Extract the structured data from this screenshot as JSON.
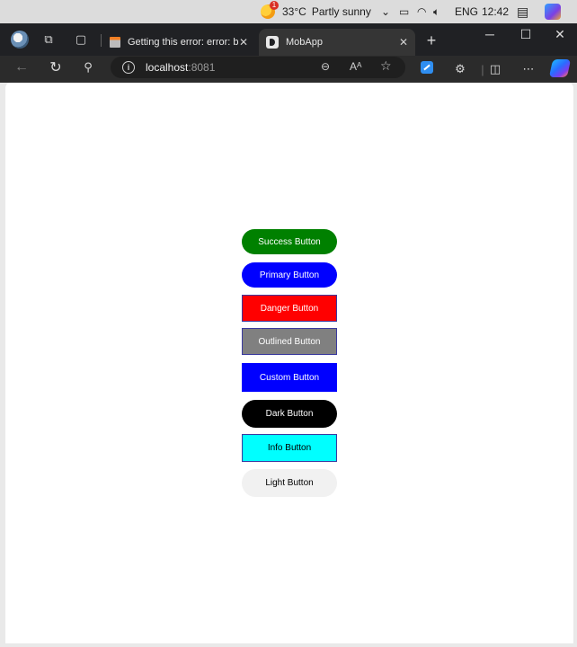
{
  "taskbar": {
    "weather_icon": "weather-sun-icon",
    "temperature": "33°C",
    "condition": "Partly sunny",
    "language": "ENG",
    "time": "12:42"
  },
  "browser": {
    "tabs": [
      {
        "title": "Getting this error: error: bu",
        "active": false
      },
      {
        "title": "MobApp",
        "active": true
      }
    ],
    "address": {
      "host": "localhost",
      "port": ":8081"
    }
  },
  "buttons": [
    {
      "label": "Success Button",
      "bg": "#008000",
      "color": "#ffffff",
      "shape": "pill"
    },
    {
      "label": "Primary Button",
      "bg": "#0000ff",
      "color": "#ffffff",
      "shape": "pill"
    },
    {
      "label": "Danger Button",
      "bg": "#ff0000",
      "color": "#ffffff",
      "shape": "square",
      "border": "#3a3aa0"
    },
    {
      "label": "Outlined Button",
      "bg": "#808080",
      "color": "#ffffff",
      "shape": "square",
      "border": "#3a3aa0"
    },
    {
      "label": "Custom Button",
      "bg": "#0000ff",
      "color": "#ffffff",
      "shape": "square"
    },
    {
      "label": "Dark Button",
      "bg": "#000000",
      "color": "#ffffff",
      "shape": "pill"
    },
    {
      "label": "Info Button",
      "bg": "#00ffff",
      "color": "#000000",
      "shape": "square",
      "border": "#3a3aa0"
    },
    {
      "label": "Light Button",
      "bg": "#f1f1f1",
      "color": "#000000",
      "shape": "pill"
    }
  ]
}
